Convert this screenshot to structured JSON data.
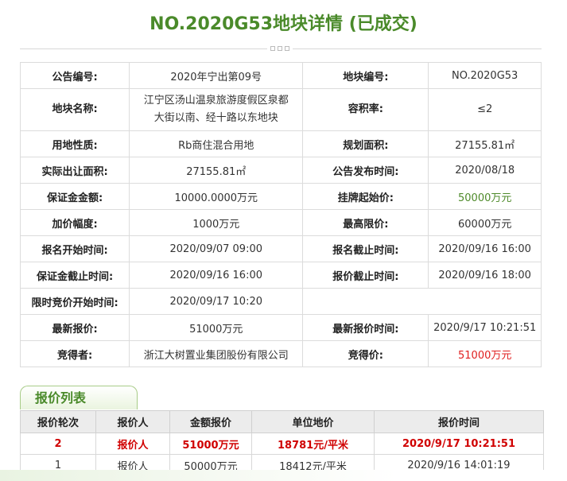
{
  "title": "NO.2020G53地块详情 (已成交)",
  "info": [
    {
      "k1": "公告编号:",
      "v1": "2020年宁出第09号",
      "k2": "地块编号:",
      "v2": "NO.2020G53"
    },
    {
      "k1": "地块名称:",
      "v1a": "江宁区汤山温泉旅游度假区泉都",
      "v1b": "大街以南、经十路以东地块",
      "k2": "容积率:",
      "v2": "≤2"
    },
    {
      "k1": "用地性质:",
      "v1": "Rb商住混合用地",
      "k2": "规划面积:",
      "v2": "27155.81㎡"
    },
    {
      "k1": "实际出让面积:",
      "v1": "27155.81㎡",
      "k2": "公告发布时间:",
      "v2": "2020/08/18"
    },
    {
      "k1": "保证金金额:",
      "v1": "10000.0000万元",
      "k2": "挂牌起始价:",
      "v2": "50000万元"
    },
    {
      "k1": "加价幅度:",
      "v1": "1000万元",
      "k2": "最高限价:",
      "v2": "60000万元"
    },
    {
      "k1": "报名开始时间:",
      "v1": "2020/09/07 09:00",
      "k2": "报名截止时间:",
      "v2": "2020/09/16 16:00"
    },
    {
      "k1": "保证金截止时间:",
      "v1": "2020/09/16 16:00",
      "k2": "报价截止时间:",
      "v2": "2020/09/16 18:00"
    },
    {
      "k1": "限时竞价开始时间:",
      "v1": "2020/09/17 10:20"
    },
    {
      "k1": "最新报价:",
      "v1": "51000万元",
      "k2": "最新报价时间:",
      "v2": "2020/9/17 10:21:51"
    },
    {
      "k1": "竞得者:",
      "v1": "浙江大树置业集团股份有限公司",
      "k2": "竞得价:",
      "v2": "51000万元"
    }
  ],
  "bids_tab": "报价列表",
  "bids_headers": [
    "报价轮次",
    "报价人",
    "金额报价",
    "单位地价",
    "报价时间"
  ],
  "bids_rows": [
    [
      "2",
      "报价人",
      "51000万元",
      "18781元/平米",
      "2020/9/17 10:21:51"
    ],
    [
      "1",
      "报价人",
      "50000万元",
      "18412元/平米",
      "2020/9/16 14:01:19"
    ]
  ],
  "colors": {
    "accent": "#4a8a2a",
    "highlight": "#e02020"
  }
}
